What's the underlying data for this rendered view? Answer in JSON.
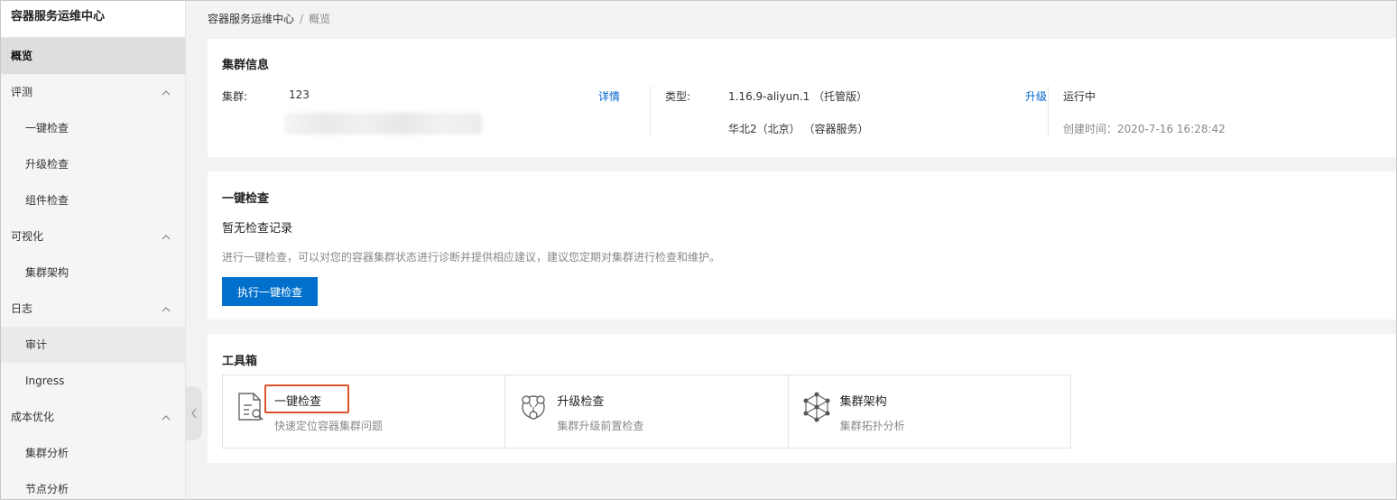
{
  "sidebar": {
    "title": "容器服务运维中心",
    "items": [
      {
        "label": "概览",
        "level": 0,
        "active": true
      },
      {
        "label": "评测",
        "level": 0,
        "group": true
      },
      {
        "label": "一键检查",
        "level": 1
      },
      {
        "label": "升级检查",
        "level": 1
      },
      {
        "label": "组件检查",
        "level": 1
      },
      {
        "label": "可视化",
        "level": 0,
        "group": true
      },
      {
        "label": "集群架构",
        "level": 1
      },
      {
        "label": "日志",
        "level": 0,
        "group": true
      },
      {
        "label": "审计",
        "level": 1,
        "highlight": true
      },
      {
        "label": "Ingress",
        "level": 1
      },
      {
        "label": "成本优化",
        "level": 0,
        "group": true
      },
      {
        "label": "集群分析",
        "level": 1
      },
      {
        "label": "节点分析",
        "level": 1
      }
    ]
  },
  "breadcrumb": {
    "root": "容器服务运维中心",
    "sep": "/",
    "current": "概览"
  },
  "cluster_info": {
    "title": "集群信息",
    "cluster_label": "集群:",
    "cluster_value": "123",
    "details_link": "详情",
    "type_label": "类型:",
    "type_value": "1.16.9-aliyun.1 （托管版）",
    "region_value": "华北2（北京） （容器服务）",
    "upgrade_link": "升级",
    "status": "运行中",
    "created": "创建时间：2020-7-16 16:28:42"
  },
  "quick_check": {
    "title": "一键检查",
    "no_record": "暂无检查记录",
    "description": "进行一键检查，可以对您的容器集群状态进行诊断并提供相应建议，建议您定期对集群进行检查和维护。",
    "button": "执行一键检查"
  },
  "toolbox": {
    "title": "工具箱",
    "tools": [
      {
        "name": "一键检查",
        "desc": "快速定位容器集群问题",
        "icon": "document-search-icon"
      },
      {
        "name": "升级检查",
        "desc": "集群升级前置检查",
        "icon": "triangle-nodes-icon"
      },
      {
        "name": "集群架构",
        "desc": "集群拓扑分析",
        "icon": "topology-icon"
      }
    ]
  },
  "colors": {
    "accent": "#0070cc",
    "link": "#0064c8",
    "highlight_box": "#e0502a"
  }
}
